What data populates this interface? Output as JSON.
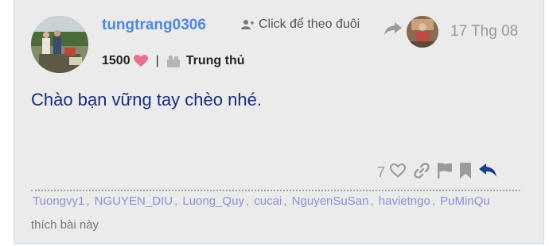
{
  "post": {
    "username": "tungtrang0306",
    "follow_label": "Click để theo đuôi",
    "date": "17 Thg 08",
    "score": "1500",
    "badge_label": "Trung thủ",
    "message": "Chào bạn vững tay chèo nhé.",
    "like_count": "7"
  },
  "likers": {
    "names": [
      "Tuongvy1",
      "NGUYEN_DIU",
      "Luong_Quy",
      "cucai",
      "NguyenSuSan",
      "havietngo",
      "PuMinQu"
    ],
    "suffix": "thích bài này"
  },
  "colors": {
    "username": "#4f87dc",
    "message": "#1a2e7a",
    "liker_link": "#8a93d8",
    "heart": "#e8708c",
    "reply_arrow": "#1f3c8c"
  },
  "icons": [
    "user-plus-icon",
    "share-icon",
    "heart-icon",
    "badge-icon",
    "link-icon",
    "flag-icon",
    "bookmark-icon",
    "reply-icon"
  ]
}
